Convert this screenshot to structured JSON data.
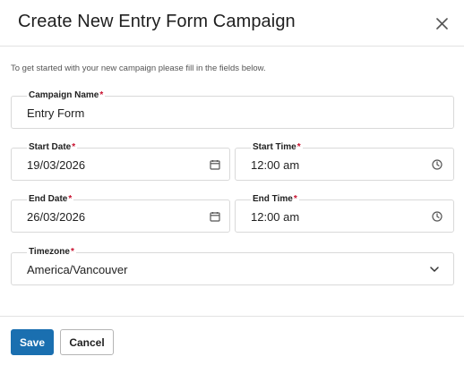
{
  "dialog": {
    "title": "Create New Entry Form Campaign",
    "close_icon": "close-icon",
    "intro": "To get started with your new campaign please fill in the fields below."
  },
  "form": {
    "required_marker": "*",
    "campaign_name": {
      "label": "Campaign Name",
      "value": "Entry Form"
    },
    "start_date": {
      "label": "Start Date",
      "value": "19/03/2026",
      "icon": "calendar-icon"
    },
    "start_time": {
      "label": "Start Time",
      "value": "12:00 am",
      "icon": "clock-icon"
    },
    "end_date": {
      "label": "End Date",
      "value": "26/03/2026",
      "icon": "calendar-icon"
    },
    "end_time": {
      "label": "End Time",
      "value": "12:00 am",
      "icon": "clock-icon"
    },
    "timezone": {
      "label": "Timezone",
      "value": "America/Vancouver",
      "icon": "chevron-down-icon"
    }
  },
  "footer": {
    "save_label": "Save",
    "cancel_label": "Cancel"
  },
  "colors": {
    "primary": "#1a6fb0",
    "required": "#c8102e",
    "border": "#d9d9d9"
  }
}
